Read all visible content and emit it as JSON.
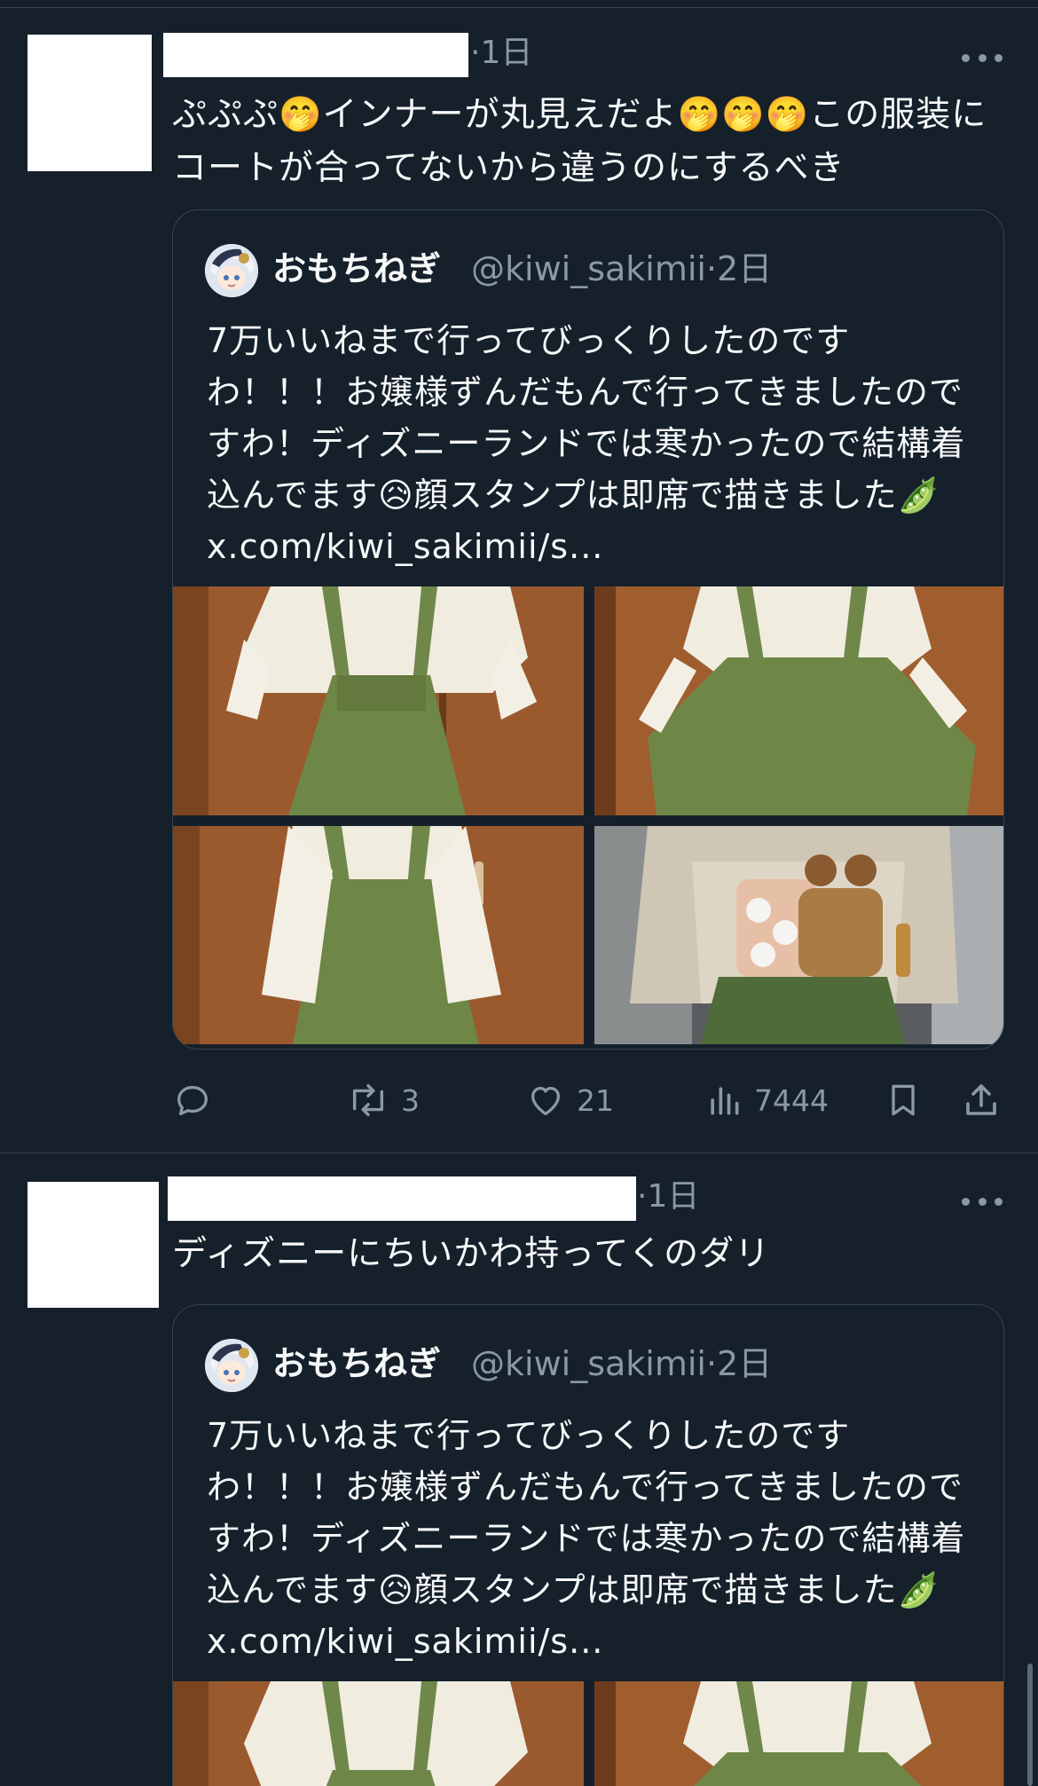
{
  "colors": {
    "background": "#15202b",
    "text": "#f7f9f9",
    "secondary_text": "#8b98a5",
    "border": "#38444d"
  },
  "tweets": [
    {
      "time": "·1日",
      "text": "ぷぷぷ🤭インナーが丸見えだよ🤭🤭🤭この服装にコートが合ってないから違うのにするべき",
      "more_icon": "more-horizontal-icon",
      "quote": {
        "name": "おもちねぎ",
        "handle": "@kiwi_sakimii·2日",
        "text": "7万いいねまで行ってびっくりしたのですわ！！！お嬢様ずんだもんで行ってきましたのですわ！ディズニーランドでは寒かったので結構着込んでます😥顔スタンプは即席で描きました🫛 x.com/kiwi_sakimii/s...",
        "photos": [
          "photo-1",
          "photo-2",
          "photo-3",
          "photo-4"
        ]
      },
      "actions": {
        "reply_icon": "reply-icon",
        "retweet_icon": "retweet-icon",
        "retweet_count": "3",
        "like_icon": "heart-icon",
        "like_count": "21",
        "views_icon": "views-icon",
        "views_count": "7444",
        "bookmark_icon": "bookmark-icon",
        "share_icon": "share-icon"
      }
    },
    {
      "time": "·1日",
      "text": "ディズニーにちいかわ持ってくのダリ",
      "more_icon": "more-horizontal-icon",
      "quote": {
        "name": "おもちねぎ",
        "handle": "@kiwi_sakimii·2日",
        "text": "7万いいねまで行ってびっくりしたのですわ！！！お嬢様ずんだもんで行ってきましたのですわ！ディズニーランドでは寒かったので結構着込んでます😥顔スタンプは即席で描きました🫛 x.com/kiwi_sakimii/s..."
      }
    }
  ]
}
